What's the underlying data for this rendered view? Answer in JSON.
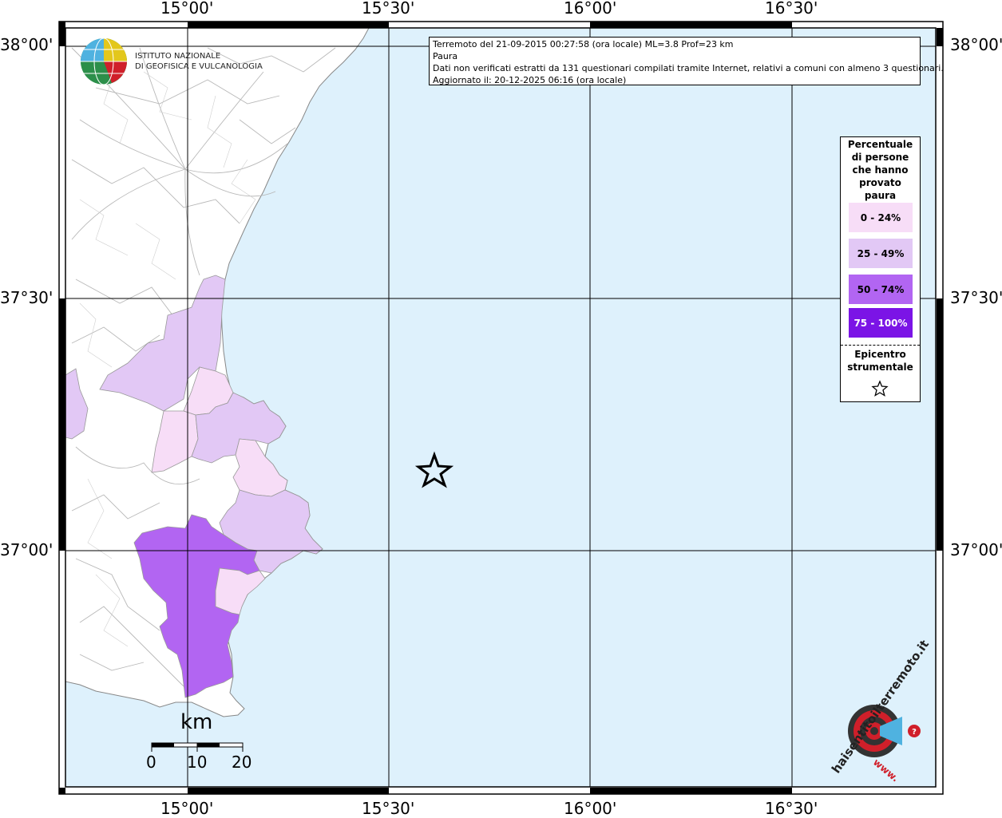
{
  "axes": {
    "top_labels": [
      "15°00'",
      "15°30'",
      "16°00'",
      "16°30'"
    ],
    "bottom_labels": [
      "15°00'",
      "15°30'",
      "16°00'",
      "16°30'"
    ],
    "left_labels": [
      "38°00'",
      "37°30'",
      "37°00'"
    ],
    "right_labels": [
      "38°00'",
      "37°30'",
      "37°00'"
    ]
  },
  "info": {
    "line1": "Terremoto del 21-09-2015 00:27:58 (ora locale) ML=3.8 Prof=23 km",
    "line2": "Paura",
    "line3": "Dati non verificati estratti da 131 questionari compilati tramite Internet, relativi a comuni con almeno 3 questionari.",
    "line4": "Aggiornato il: 20-12-2025 06:16 (ora locale)"
  },
  "logo": {
    "line1": "ISTITUTO NAZIONALE",
    "line2": "DI GEOFISICA E VULCANOLOGIA"
  },
  "legend": {
    "title_lines": [
      "Percentuale",
      "di persone",
      "che hanno",
      "provato",
      "paura"
    ],
    "items": [
      {
        "label": "0 - 24%",
        "color": "#f7ddf7"
      },
      {
        "label": "25 - 49%",
        "color": "#e2c8f5"
      },
      {
        "label": "50 - 74%",
        "color": "#b265f2"
      },
      {
        "label": "75 - 100%",
        "color": "#7b14e6"
      }
    ],
    "epicenter_lines": [
      "Epicentro",
      "strumentale"
    ]
  },
  "scale": {
    "unit": "km",
    "ticks": [
      "0",
      "10",
      "20"
    ]
  },
  "brand": {
    "text": "haisentitoilterremoto.it",
    "www": "www."
  },
  "colors": {
    "sea": "#def1fc",
    "land": "#ffffff",
    "grid": "#000000"
  }
}
